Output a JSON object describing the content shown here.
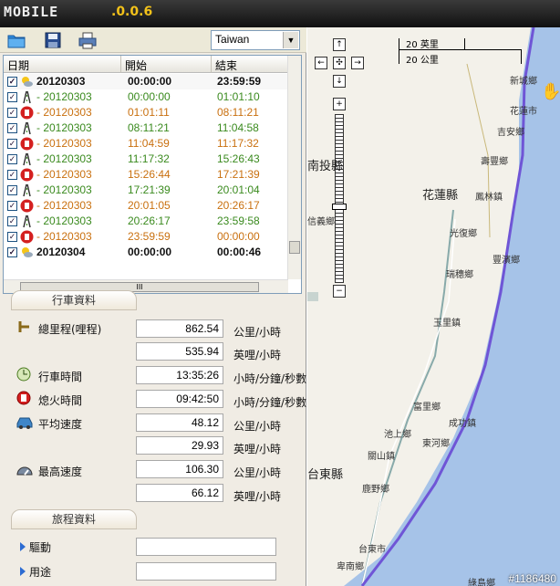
{
  "titlebar": {
    "logo": "MOBILE",
    "version": ".0.0.6"
  },
  "toolbar": {
    "region": "Taiwan"
  },
  "grid": {
    "columns": [
      "日期",
      "開始",
      "結束"
    ],
    "rows": [
      {
        "date": "20120303",
        "start": "00:00:00",
        "end": "23:59:59",
        "type": "day"
      },
      {
        "date": "- 20120303",
        "start": "00:00:00",
        "end": "01:01:10",
        "type": "move"
      },
      {
        "date": "- 20120303",
        "start": "01:01:11",
        "end": "08:11:21",
        "type": "stop"
      },
      {
        "date": "- 20120303",
        "start": "08:11:21",
        "end": "11:04:58",
        "type": "move"
      },
      {
        "date": "- 20120303",
        "start": "11:04:59",
        "end": "11:17:32",
        "type": "stop"
      },
      {
        "date": "- 20120303",
        "start": "11:17:32",
        "end": "15:26:43",
        "type": "move"
      },
      {
        "date": "- 20120303",
        "start": "15:26:44",
        "end": "17:21:39",
        "type": "stop"
      },
      {
        "date": "- 20120303",
        "start": "17:21:39",
        "end": "20:01:04",
        "type": "move"
      },
      {
        "date": "- 20120303",
        "start": "20:01:05",
        "end": "20:26:17",
        "type": "stop"
      },
      {
        "date": "- 20120303",
        "start": "20:26:17",
        "end": "23:59:58",
        "type": "move"
      },
      {
        "date": "- 20120303",
        "start": "23:59:59",
        "end": "00:00:00",
        "type": "stop"
      },
      {
        "date": "20120304",
        "start": "00:00:00",
        "end": "00:00:46",
        "type": "day"
      }
    ],
    "hscroll_label": "III"
  },
  "trip": {
    "section_title": "行車資料",
    "mileage_label": "總里程(哩程)",
    "mileage_km": "862.54",
    "mileage_mi": "535.94",
    "drive_time_label": "行車時間",
    "drive_time": "13:35:26",
    "idle_label": "熄火時間",
    "idle_time": "09:42:50",
    "avg_label": "平均速度",
    "avg_km": "48.12",
    "avg_mi": "29.93",
    "max_label": "最高速度",
    "max_km": "106.30",
    "max_mi": "66.12",
    "unit_kmh": "公里/小時",
    "unit_mph": "英哩/小時",
    "unit_time": "小時/分鐘/秒數"
  },
  "travel": {
    "section_title": "旅程資料",
    "driver_label": "驅動",
    "purpose_label": "用途"
  },
  "map": {
    "scale_mi": "20 英里",
    "scale_km": "20 公里",
    "labels": {
      "xincheng": "新城鄉",
      "hualien_city": "花蓮市",
      "jian": "吉安鄉",
      "shoufeng": "壽豐鄉",
      "nantou": "南投縣",
      "hualien_county": "花蓮縣",
      "fenglin": "鳳林鎮",
      "xinyi": "信義鄉",
      "guangfu": "光復鄉",
      "fengbin": "豐濱鄉",
      "ruisui": "瑞穗鄉",
      "yuli": "玉里鎮",
      "fuli": "富里鄉",
      "chenggong": "成功鎮",
      "chishang": "池上鄉",
      "donghe": "東河鄉",
      "guanshan": "關山鎮",
      "taitung_county": "台東縣",
      "luye": "鹿野鄉",
      "taitung_city": "台東市",
      "beinan": "卑南鄉",
      "lvdao": "綠島鄉"
    },
    "watermark": "#1186480"
  }
}
